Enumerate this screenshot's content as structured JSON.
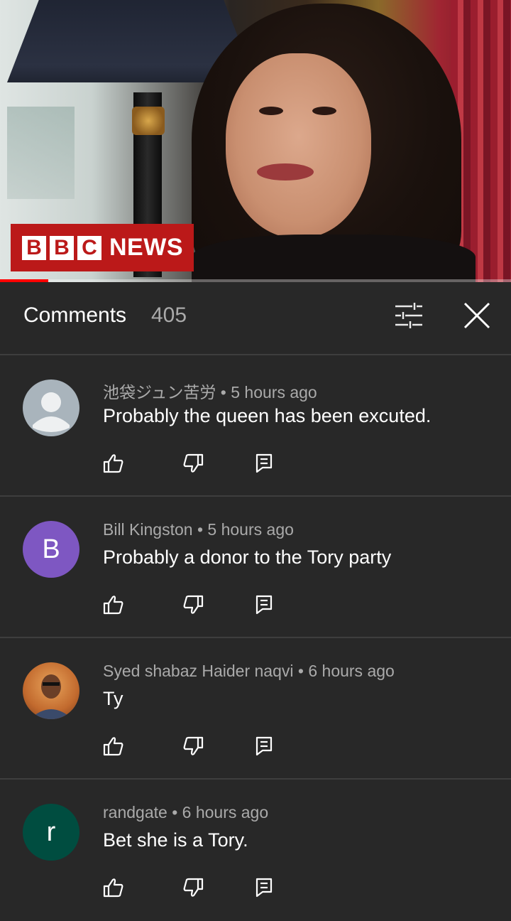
{
  "video": {
    "logo": {
      "boxes": [
        "B",
        "B",
        "C"
      ],
      "word": "NEWS"
    },
    "progress": 0.095,
    "colors": {
      "progress": "#ff0000",
      "logo_bg": "#bb1919"
    }
  },
  "header": {
    "title": "Comments",
    "count": "405",
    "filter_icon": "sort-filter-icon",
    "close_icon": "close-icon"
  },
  "comments": [
    {
      "author": "池袋ジュン苦労",
      "separator": "•",
      "time": "5 hours ago",
      "text": "Probably the queen has been excuted.",
      "avatar_letter": "",
      "avatar_color": "#a9b4bc"
    },
    {
      "author": "Bill Kingston",
      "separator": "•",
      "time": "5 hours ago",
      "text": "Probably a donor to the Tory party",
      "avatar_letter": "B",
      "avatar_color": "#7e57c2"
    },
    {
      "author": "Syed shabaz Haider naqvi",
      "separator": "•",
      "time": "6 hours ago",
      "text": "Ty",
      "avatar_letter": "",
      "avatar_color": "#c26a2e"
    },
    {
      "author": "randgate",
      "separator": "•",
      "time": "6 hours ago",
      "text": "Bet she is a Tory.",
      "avatar_letter": "r",
      "avatar_color": "#004d40"
    }
  ],
  "action_icons": [
    "thumbs-up-icon",
    "thumbs-down-icon",
    "reply-icon"
  ]
}
